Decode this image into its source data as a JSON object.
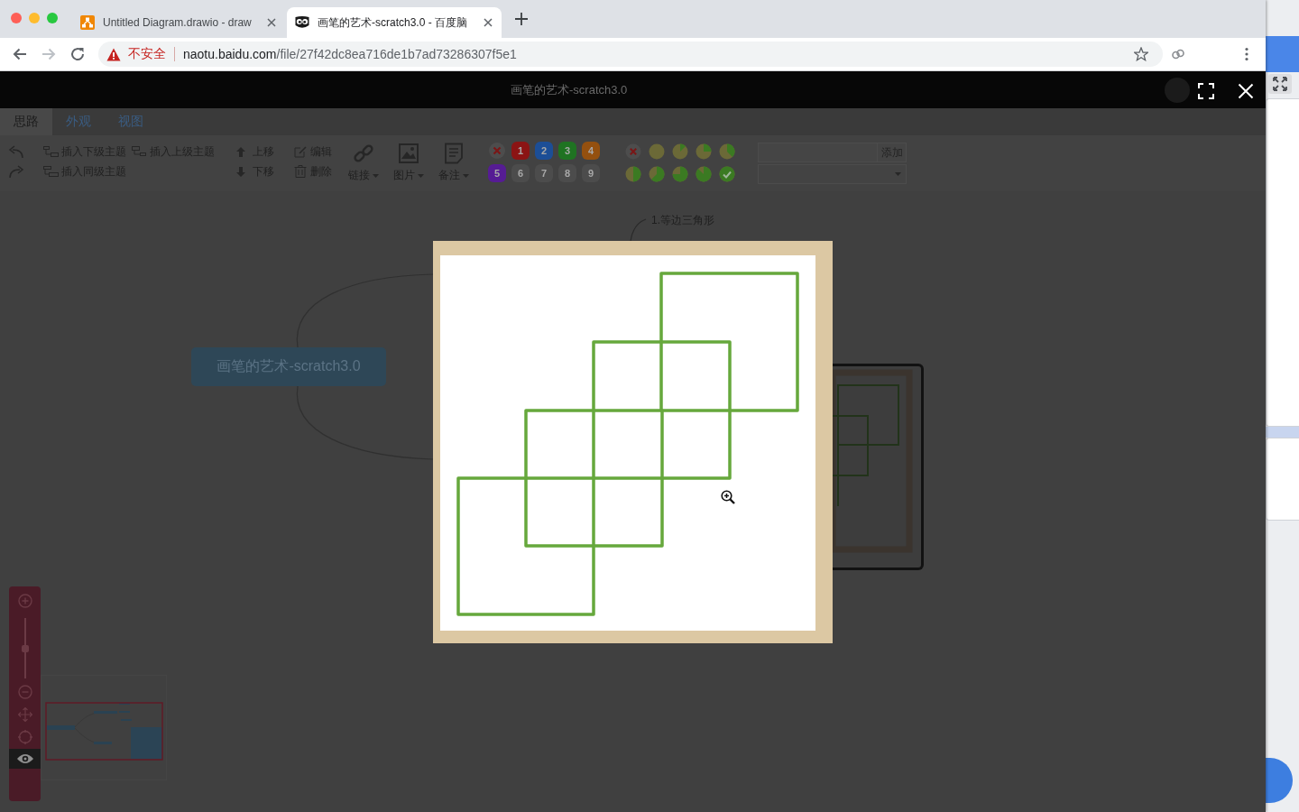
{
  "browser": {
    "tabs": [
      {
        "kind": "drawio",
        "title": "Untitled Diagram.drawio - draw",
        "selected": false
      },
      {
        "kind": "owl",
        "title": "画笔的艺术-scratch3.0 - 百度脑",
        "selected": true
      }
    ],
    "forward_disabled": true,
    "address": {
      "security": "不安全",
      "host": "naotu.baidu.com",
      "path": "/file/27f42dc8ea716de1b7ad73286307f5e1"
    }
  },
  "app": {
    "title": "画笔的艺术-scratch3.0",
    "tabs": [
      {
        "label": "思路",
        "selected": true
      },
      {
        "label": "外观",
        "selected": false
      },
      {
        "label": "视图",
        "selected": false
      }
    ],
    "toolbar": {
      "insert": [
        {
          "kind": "child",
          "label": "插入下级主题"
        },
        {
          "kind": "parent",
          "label": "插入上级主题"
        },
        {
          "kind": "sibling",
          "label": "插入同级主题"
        }
      ],
      "order": [
        {
          "kind": "up",
          "label": "上移"
        },
        {
          "kind": "down",
          "label": "下移"
        }
      ],
      "edit": [
        {
          "kind": "edit",
          "label": "编辑"
        },
        {
          "kind": "delete",
          "label": "删除"
        }
      ],
      "menus": [
        {
          "kind": "link",
          "label": "链接"
        },
        {
          "kind": "image",
          "label": "图片"
        },
        {
          "kind": "note",
          "label": "备注"
        }
      ],
      "priorities": [
        {
          "kind": "clear"
        },
        {
          "kind": "number",
          "label": "1",
          "color": "#8b1414"
        },
        {
          "kind": "number",
          "label": "2",
          "color": "#1c4e96"
        },
        {
          "kind": "number",
          "label": "3",
          "color": "#1f7322"
        },
        {
          "kind": "number",
          "label": "4",
          "color": "#94500f"
        },
        {
          "kind": "number",
          "label": "5",
          "color": "#561c94"
        },
        {
          "kind": "number",
          "label": "6",
          "color": "#4c4c4c"
        },
        {
          "kind": "number",
          "label": "7",
          "color": "#4c4c4c"
        },
        {
          "kind": "number",
          "label": "8",
          "color": "#4c4c4c"
        },
        {
          "kind": "number",
          "label": "9",
          "color": "#4c4c4c"
        }
      ],
      "progress": [
        {
          "kind": "clear"
        },
        {
          "kind": "empty"
        },
        {
          "kind": "eighth"
        },
        {
          "kind": "quarter"
        },
        {
          "kind": "three-eighths"
        },
        {
          "kind": "half"
        },
        {
          "kind": "five-eighths"
        },
        {
          "kind": "three-quarters"
        },
        {
          "kind": "seven-eighths"
        },
        {
          "kind": "done"
        }
      ],
      "resource": {
        "button": "添加"
      }
    },
    "mindmap": {
      "root": "画笔的艺术-scratch3.0",
      "child": "1.等边三角形"
    },
    "zoom": {
      "level": 0.5,
      "navigator_on": true
    }
  }
}
